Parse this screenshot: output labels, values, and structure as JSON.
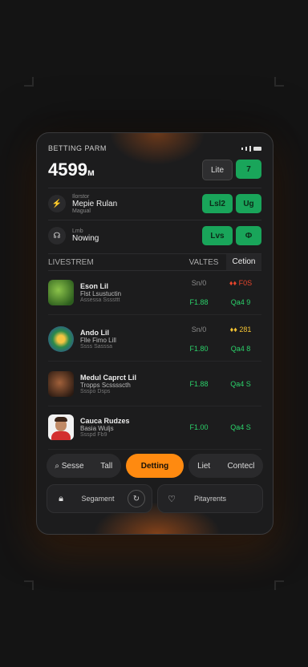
{
  "app": {
    "title": "BETTING PARM"
  },
  "balance": {
    "amount": "4599",
    "unit": "м"
  },
  "top_buttons": {
    "live": "Lite",
    "go": "7"
  },
  "features": [
    {
      "small": "Ilorstor",
      "main": "Mepie Rulan",
      "sub": "Magual",
      "btn1": "Lsl2",
      "btn2": "Ug",
      "icon": "bolt-icon"
    },
    {
      "small": "Lmb",
      "main": "Nowing",
      "sub": "",
      "btn1": "Lvs",
      "btn2": "Ф",
      "icon": "headset-icon"
    }
  ],
  "table": {
    "live": "LIVESTREM",
    "values": "VALTES",
    "option": "Cetion"
  },
  "rows": [
    {
      "name": "Eson Lil",
      "desc": "Flst Lsustuctin",
      "meta": "Assessa Ssssttt",
      "v1": "Sn/0",
      "v2": "♦♦ F0S",
      "v3": "F1.88",
      "v4": "Qa4 9"
    },
    {
      "name": "Ando Lil",
      "desc": "Flle Fimo Lill",
      "meta": "Ssss Sasssa",
      "v1": "Sn/0",
      "v2": "♦♦ 281",
      "v3": "F1.80",
      "v4": "Qa4 8"
    },
    {
      "name": "Medul Caprct Lil",
      "desc": "Tropps Scsssscth",
      "meta": "Ssspo Dsps",
      "v1": "",
      "v2": "",
      "v3": "F1.88",
      "v4": "Qa4 S"
    },
    {
      "name": "Cauca Rudzes",
      "desc": "Basia Wuljs",
      "meta": "Ssspd Fb9",
      "v1": "",
      "v2": "",
      "v3": "F1.00",
      "v4": "Qa4 S"
    }
  ],
  "tabs": {
    "search": "Sesse",
    "tall": "Tall",
    "betting": "Detting",
    "list": "Liet",
    "contest": "Contecl"
  },
  "bottom": {
    "segment": "Segament",
    "payments": "Pitayrents"
  }
}
